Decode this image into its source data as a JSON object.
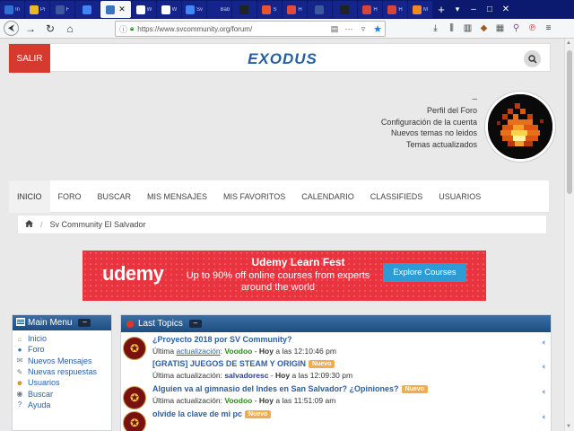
{
  "browser": {
    "tabs": [
      {
        "label": "In",
        "color": "#2f6fd6"
      },
      {
        "label": "Pi",
        "color": "#e8b923"
      },
      {
        "label": "F",
        "color": "#3b5998"
      },
      {
        "label": "",
        "color": "#4285f4"
      },
      {
        "label": "",
        "color": "#3b74c4",
        "active": true
      },
      {
        "label": "W",
        "color": "#ffffff"
      },
      {
        "label": "W",
        "color": "#ffffff"
      },
      {
        "label": "Sv",
        "color": "#4285f4"
      },
      {
        "label": "Baby",
        "color": "#14248a"
      },
      {
        "label": "",
        "color": "#222222"
      },
      {
        "label": "S",
        "color": "#e8542c"
      },
      {
        "label": "H",
        "color": "#e04b3b"
      },
      {
        "label": "",
        "color": "#3b5998"
      },
      {
        "label": "",
        "color": "#222222"
      },
      {
        "label": "H",
        "color": "#d64538"
      },
      {
        "label": "H",
        "color": "#d64538"
      },
      {
        "label": "M",
        "color": "#f08a24"
      }
    ],
    "url": "https://www.svcommunity.org/forum/",
    "new_tab": "+"
  },
  "header": {
    "salir": "SALIR",
    "logo": "EXODUS"
  },
  "user_menu": {
    "dash": "–",
    "links": [
      "Perfil del Foro",
      "Configuración de la cuenta",
      "Nuevos temas no leidos",
      "Temas actualizados"
    ]
  },
  "nav": {
    "items": [
      "INICIO",
      "FORO",
      "BUSCAR",
      "MIS MENSAJES",
      "MIS FAVORITOS",
      "CALENDARIO",
      "CLASSIFIEDS",
      "USUARIOS"
    ]
  },
  "breadcrumb": {
    "current": "Sv Community El Salvador"
  },
  "ad": {
    "brand": "udemy",
    "title": "Udemy Learn Fest",
    "text": "Up to 90% off online courses from experts around the world",
    "cta": "Explore Courses"
  },
  "main_menu": {
    "title": "Main Menu",
    "collapse": "–",
    "items": [
      {
        "label": "Inicio",
        "icon": "home-icon",
        "color": "#d98a1a",
        "glyph": "⌂"
      },
      {
        "label": "Foro",
        "icon": "forum-icon",
        "color": "#2a6fc0",
        "glyph": "●"
      },
      {
        "label": "Nuevos Mensajes",
        "icon": "mail-icon",
        "color": "#6a7a8a",
        "glyph": "✉"
      },
      {
        "label": "Nuevas respuestas",
        "icon": "reply-icon",
        "color": "#6a7a8a",
        "glyph": "✎"
      },
      {
        "label": "Usuarios",
        "icon": "users-icon",
        "color": "#d98a1a",
        "glyph": "☻"
      },
      {
        "label": "Buscar",
        "icon": "search-icon",
        "color": "#6a7a8a",
        "glyph": "◉"
      },
      {
        "label": "Ayuda",
        "icon": "help-icon",
        "color": "#2a6fc0",
        "glyph": "?"
      }
    ]
  },
  "last_topics": {
    "title": "Last Topics",
    "collapse": "–",
    "topics": [
      {
        "title": "¿Proyecto 2018 por SV Community?",
        "badge": "",
        "has_icon": true,
        "prefix": "Última",
        "link": "actualización",
        "colon": ":",
        "author": "Voodoo",
        "author_color": "#2b8a1e",
        "day": "Hoy",
        "time": "a las 12:10:46 pm"
      },
      {
        "title": "[GRATIS] JUEGOS DE STEAM Y ORIGIN",
        "badge": "Nuevo",
        "has_icon": false,
        "prefix": "Última actualización:",
        "link": "",
        "colon": "",
        "author": "salvadoresc",
        "author_color": "#2a3f8a",
        "day": "Hoy",
        "time": "a las 12:09:30 pm"
      },
      {
        "title": "Alguien va al gimnasio del Indes en San Salvador? ¿Opiniones?",
        "badge": "Nuevo",
        "has_icon": true,
        "prefix": "Última actualización:",
        "link": "",
        "colon": "",
        "author": "Voodoo",
        "author_color": "#2b8a1e",
        "day": "Hoy",
        "time": "a las 11:51:09 am"
      },
      {
        "title": "olvide la clave de mi pc",
        "badge": "Nuevo",
        "has_icon": true,
        "prefix": "",
        "link": "",
        "colon": "",
        "author": "",
        "author_color": "#333333",
        "day": "",
        "time": ""
      }
    ]
  }
}
